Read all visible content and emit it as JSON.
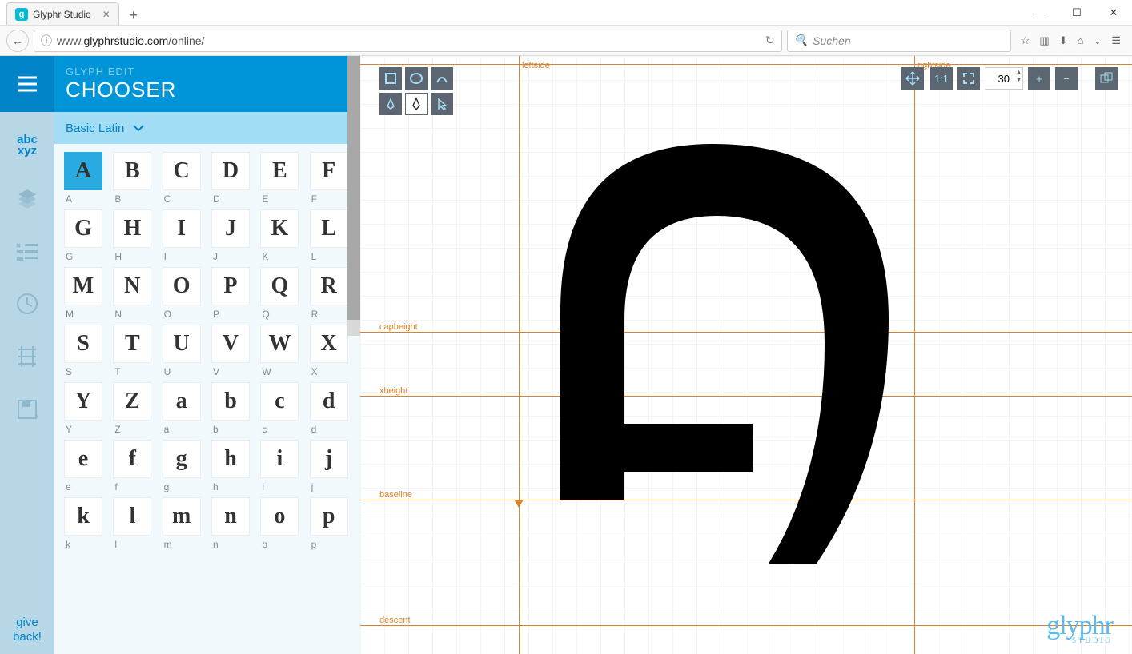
{
  "browser": {
    "tab_title": "Glyphr Studio",
    "url_prefix": "www.",
    "url_domain": "glyphrstudio.com",
    "url_path": "/online/",
    "search_placeholder": "Suchen",
    "favicon_letter": "g"
  },
  "header": {
    "subtitle": "GLYPH EDIT",
    "title": "CHOOSER"
  },
  "range": {
    "label": "Basic Latin"
  },
  "rail": {
    "abc": "abc",
    "xyz": "xyz",
    "give": "give",
    "back": "back!"
  },
  "glyphs": [
    {
      "g": "A",
      "l": "A",
      "sel": true
    },
    {
      "g": "B",
      "l": "B"
    },
    {
      "g": "C",
      "l": "C"
    },
    {
      "g": "D",
      "l": "D"
    },
    {
      "g": "E",
      "l": "E"
    },
    {
      "g": "F",
      "l": "F"
    },
    {
      "g": "G",
      "l": "G"
    },
    {
      "g": "H",
      "l": "H"
    },
    {
      "g": "I",
      "l": "I"
    },
    {
      "g": "J",
      "l": "J"
    },
    {
      "g": "K",
      "l": "K"
    },
    {
      "g": "L",
      "l": "L"
    },
    {
      "g": "M",
      "l": "M"
    },
    {
      "g": "N",
      "l": "N"
    },
    {
      "g": "O",
      "l": "O"
    },
    {
      "g": "P",
      "l": "P"
    },
    {
      "g": "Q",
      "l": "Q"
    },
    {
      "g": "R",
      "l": "R"
    },
    {
      "g": "S",
      "l": "S"
    },
    {
      "g": "T",
      "l": "T"
    },
    {
      "g": "U",
      "l": "U"
    },
    {
      "g": "V",
      "l": "V"
    },
    {
      "g": "W",
      "l": "W"
    },
    {
      "g": "X",
      "l": "X"
    },
    {
      "g": "Y",
      "l": "Y"
    },
    {
      "g": "Z",
      "l": "Z"
    },
    {
      "g": "a",
      "l": "a"
    },
    {
      "g": "b",
      "l": "b"
    },
    {
      "g": "c",
      "l": "c"
    },
    {
      "g": "d",
      "l": "d"
    },
    {
      "g": "e",
      "l": "e"
    },
    {
      "g": "f",
      "l": "f"
    },
    {
      "g": "g",
      "l": "g"
    },
    {
      "g": "h",
      "l": "h"
    },
    {
      "g": "i",
      "l": "i"
    },
    {
      "g": "j",
      "l": "j"
    },
    {
      "g": "k",
      "l": "k"
    },
    {
      "g": "l",
      "l": "l"
    },
    {
      "g": "m",
      "l": "m"
    },
    {
      "g": "n",
      "l": "n"
    },
    {
      "g": "o",
      "l": "o"
    },
    {
      "g": "p",
      "l": "p"
    }
  ],
  "guides": {
    "leftside": "leftside",
    "rightside": "rightside",
    "capheight": "capheight",
    "xheight": "xheight",
    "baseline": "baseline",
    "descent": "descent"
  },
  "toolbar": {
    "zoom_value": "30",
    "one_to_one": "1:1"
  },
  "watermark": {
    "brand": "glyphr",
    "sub": "STUDIO"
  }
}
